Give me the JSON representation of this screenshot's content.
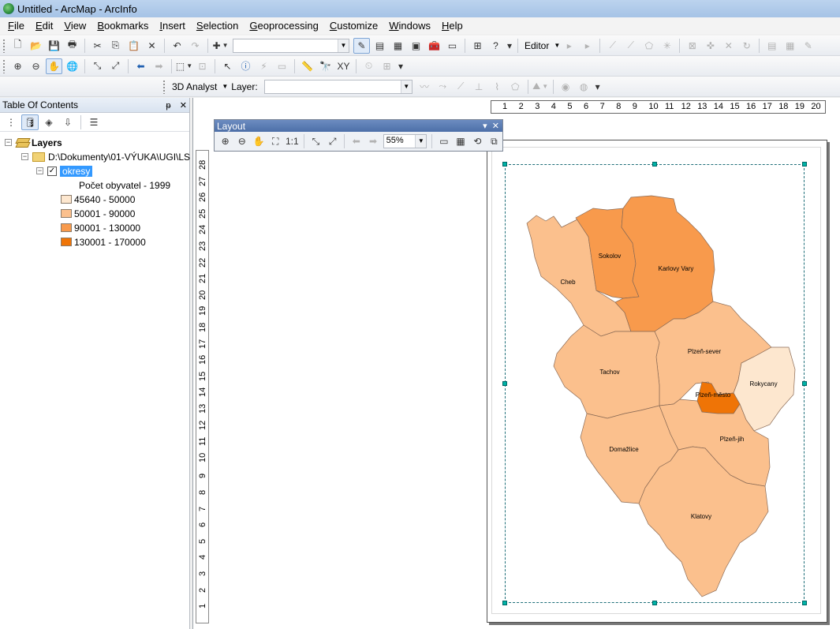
{
  "window": {
    "title": "Untitled - ArcMap - ArcInfo"
  },
  "menu": [
    {
      "pre": "",
      "ul": "F",
      "post": "ile"
    },
    {
      "pre": "",
      "ul": "E",
      "post": "dit"
    },
    {
      "pre": "",
      "ul": "V",
      "post": "iew"
    },
    {
      "pre": "",
      "ul": "B",
      "post": "ookmarks"
    },
    {
      "pre": "",
      "ul": "I",
      "post": "nsert"
    },
    {
      "pre": "",
      "ul": "S",
      "post": "election"
    },
    {
      "pre": "",
      "ul": "G",
      "post": "eoprocessing"
    },
    {
      "pre": "",
      "ul": "C",
      "post": "ustomize"
    },
    {
      "pre": "",
      "ul": "W",
      "post": "indows"
    },
    {
      "pre": "",
      "ul": "H",
      "post": "elp"
    }
  ],
  "toolbar": {
    "editor_label": "Editor",
    "analyst_label": "3D Analyst",
    "layer_label": "Layer:"
  },
  "toc": {
    "title": "Table Of Contents",
    "root": "Layers",
    "folder": "D:\\Dokumenty\\01-VÝUKA\\UGI\\LS",
    "layer": "okresy",
    "field": "Počet obyvatel - 1999",
    "legend": [
      {
        "label": "45640 - 50000",
        "color": "#fde7cf"
      },
      {
        "label": "50001 - 90000",
        "color": "#fbc08d"
      },
      {
        "label": "90001 - 130000",
        "color": "#f89a4c"
      },
      {
        "label": "130001 - 170000",
        "color": "#ef7406"
      }
    ]
  },
  "layout_toolbar": {
    "title": "Layout",
    "zoom": "55%"
  },
  "ruler": {
    "h": [
      "1",
      "2",
      "3",
      "4",
      "5",
      "6",
      "7",
      "8",
      "9",
      "10",
      "11",
      "12",
      "13",
      "14",
      "15",
      "16",
      "17",
      "18",
      "19",
      "20"
    ],
    "v": [
      "28",
      "27",
      "26",
      "25",
      "24",
      "23",
      "22",
      "21",
      "20",
      "19",
      "18",
      "17",
      "16",
      "15",
      "14",
      "13",
      "12",
      "11",
      "10",
      "9",
      "8",
      "7",
      "6",
      "5",
      "4",
      "3",
      "2",
      "1"
    ]
  },
  "map": {
    "districts": [
      {
        "name": "Cheb",
        "fill": "#fbc08d"
      },
      {
        "name": "Sokolov",
        "fill": "#f89a4c"
      },
      {
        "name": "Karlovy Vary",
        "fill": "#f89a4c"
      },
      {
        "name": "Plzeň-sever",
        "fill": "#fbc08d"
      },
      {
        "name": "Tachov",
        "fill": "#fbc08d"
      },
      {
        "name": "Rokycany",
        "fill": "#fde7cf"
      },
      {
        "name": "Plzeň-město",
        "fill": "#ef7406"
      },
      {
        "name": "Plzeň-jih",
        "fill": "#fbc08d"
      },
      {
        "name": "Domažlice",
        "fill": "#fbc08d"
      },
      {
        "name": "Klatovy",
        "fill": "#fbc08d"
      }
    ]
  }
}
